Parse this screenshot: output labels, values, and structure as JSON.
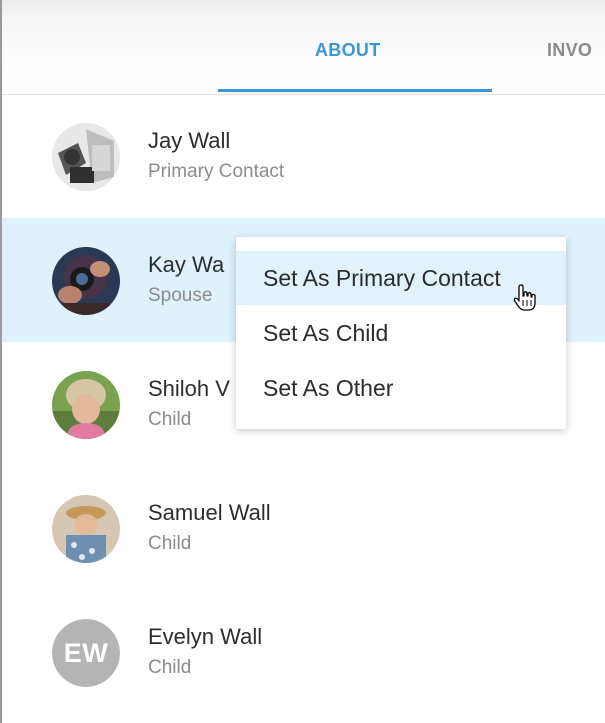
{
  "tabs": [
    {
      "label": "ABOUT",
      "active": true
    },
    {
      "label": "INVO",
      "active": false
    }
  ],
  "contacts": [
    {
      "name": "Jay Wall",
      "role": "Primary Contact",
      "avatar": "photo"
    },
    {
      "name": "Kay Wall",
      "name_visible": "Kay Wa",
      "role": "Spouse",
      "avatar": "photo",
      "selected": true
    },
    {
      "name": "Shiloh Wall",
      "name_visible": "Shiloh V",
      "role": "Child",
      "avatar": "photo"
    },
    {
      "name": "Samuel Wall",
      "role": "Child",
      "avatar": "photo"
    },
    {
      "name": "Evelyn Wall",
      "role": "Child",
      "avatar": "initials",
      "initials": "EW"
    }
  ],
  "context_menu": {
    "items": [
      {
        "label": "Set As Primary Contact",
        "hovered": true
      },
      {
        "label": "Set As Child"
      },
      {
        "label": "Set As Other"
      }
    ]
  },
  "colors": {
    "accent": "#3d97d4",
    "selected_row": "#dff1fb",
    "initials_avatar": "#b4b4b4"
  },
  "icons": [
    "hand-pointer-cursor-icon"
  ]
}
